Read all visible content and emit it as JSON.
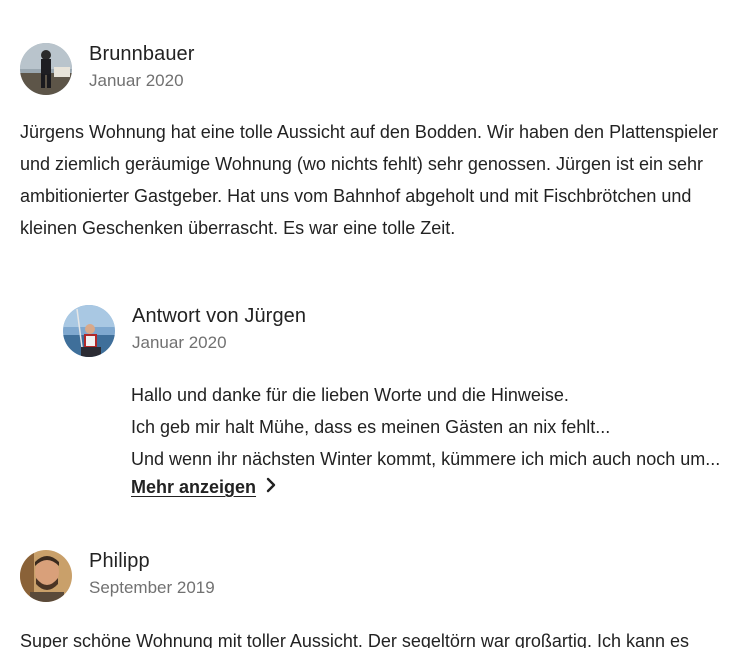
{
  "reviews": [
    {
      "name": "Brunnbauer",
      "date": "Januar 2020",
      "avatar_icon": "user-avatar-photo",
      "text_lines": [
        "Jürgens Wohnung hat eine tolle Aussicht auf den Bodden. Wir haben den Plattenspieler",
        "und ziemlich geräumige Wohnung (wo nichts fehlt) sehr genossen. Jürgen ist ein sehr",
        "ambitionierter Gastgeber. Hat uns vom Bahnhof abgeholt und mit Fischbrötchen und",
        "kleinen Geschenken überrascht. Es war eine tolle Zeit."
      ]
    },
    {
      "name": "Philipp",
      "date": "September 2019",
      "avatar_icon": "user-avatar-photo",
      "text_lines": [
        "Super schöne Wohnung mit toller Aussicht. Der segeltörn war großartig. Ich kann es"
      ]
    }
  ],
  "response": {
    "title": "Antwort von Jürgen",
    "date": "Januar 2020",
    "avatar_icon": "host-avatar-photo",
    "text_lines": [
      "Hallo und danke für die lieben Worte und die Hinweise.",
      "Ich geb mir halt Mühe, dass es meinen Gästen an nix fehlt...",
      "Und wenn ihr nächsten Winter kommt, kümmere ich mich auch noch um..."
    ],
    "show_more_label": "Mehr anzeigen",
    "show_more_icon": "chevron-right-icon"
  }
}
